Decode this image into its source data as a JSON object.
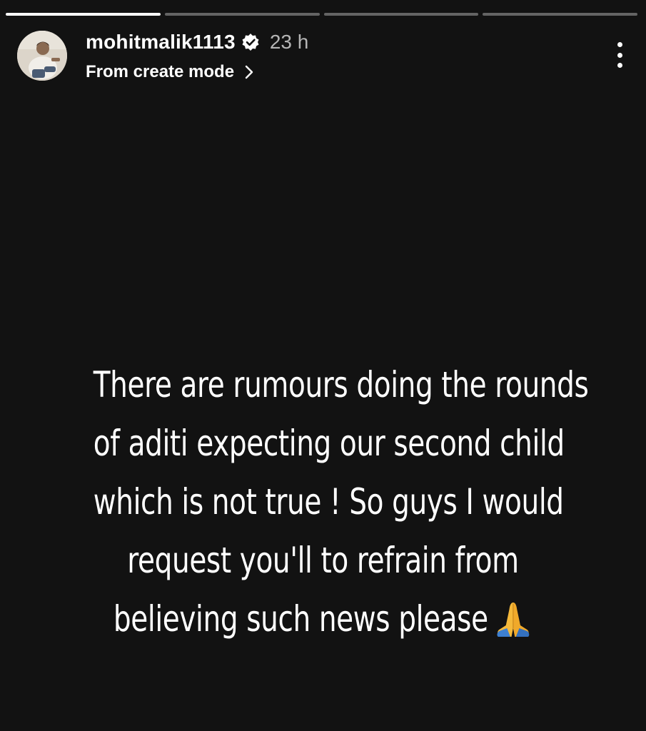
{
  "story": {
    "progress": [
      1,
      0,
      0,
      0
    ],
    "username": "mohitmalik1113",
    "verified_icon": "verified-badge-icon",
    "time": "23 h",
    "subtitle": "From create mode",
    "subtitle_icon": "chevron-right-icon",
    "menu_icon": "more-vertical-icon",
    "caption_lines": [
      "There are rumours doing the rounds",
      "of aditi expecting our second child",
      "which is not true ! So guys I would",
      "request you'll to refrain from",
      "believing such news please"
    ],
    "caption_emoji": "folded-hands-icon",
    "colors": {
      "background": "#121212",
      "text": "#ffffff",
      "muted": "#b5b5b5",
      "emoji": "#f5b93a"
    }
  }
}
